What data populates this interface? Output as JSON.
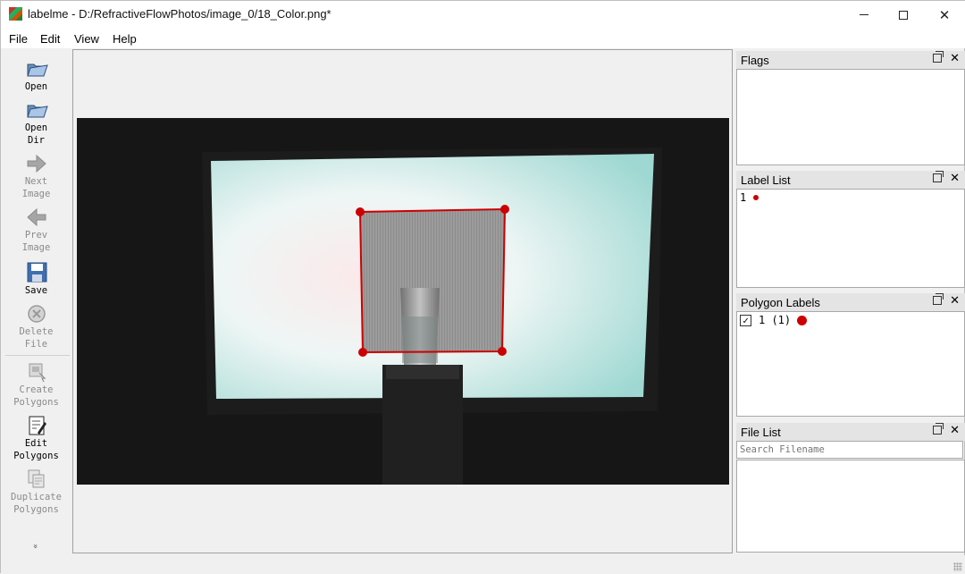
{
  "window": {
    "app_name": "labelme",
    "title": "labelme - D:/RefractiveFlowPhotos/image_0/18_Color.png*",
    "controls": {
      "minimize": "minimize",
      "maximize": "maximize",
      "close": "✕"
    }
  },
  "menu": {
    "items": [
      "File",
      "Edit",
      "View",
      "Help"
    ]
  },
  "toolbar": {
    "tools": [
      {
        "name": "open",
        "label_1": "Open",
        "label_2": "",
        "enabled": true,
        "icon": "folder-open-icon"
      },
      {
        "name": "open-dir",
        "label_1": "Open",
        "label_2": "Dir",
        "enabled": true,
        "icon": "folder-open-icon"
      },
      {
        "name": "next-image",
        "label_1": "Next",
        "label_2": "Image",
        "enabled": false,
        "icon": "arrow-right-icon"
      },
      {
        "name": "prev-image",
        "label_1": "Prev",
        "label_2": "Image",
        "enabled": false,
        "icon": "arrow-left-icon"
      },
      {
        "name": "save",
        "label_1": "Save",
        "label_2": "",
        "enabled": true,
        "icon": "floppy-disk-icon"
      },
      {
        "name": "delete-file",
        "label_1": "Delete",
        "label_2": "File",
        "enabled": false,
        "icon": "delete-circle-icon"
      },
      {
        "name": "create-polygons",
        "label_1": "Create",
        "label_2": "Polygons",
        "enabled": false,
        "icon": "create-polygon-icon"
      },
      {
        "name": "edit-polygons",
        "label_1": "Edit",
        "label_2": "Polygons",
        "enabled": true,
        "icon": "edit-document-icon"
      },
      {
        "name": "duplicate-polygons",
        "label_1": "Duplicate",
        "label_2": "Polygons",
        "enabled": false,
        "icon": "duplicate-icon"
      }
    ],
    "expand_glyph": "»"
  },
  "docks": {
    "flags": {
      "title": "Flags"
    },
    "label_list": {
      "title": "Label List",
      "items": [
        {
          "label": "1",
          "color": "#cc0000"
        }
      ]
    },
    "polygon_labels": {
      "title": "Polygon Labels",
      "items": [
        {
          "checked": true,
          "check_glyph": "✓",
          "text": "1 (1)",
          "color": "#cc0000"
        }
      ]
    },
    "file_list": {
      "title": "File List",
      "search_placeholder": "Search Filename"
    },
    "close_glyph": "✕"
  },
  "annotation": {
    "label": "1",
    "color": "#cc0000"
  }
}
